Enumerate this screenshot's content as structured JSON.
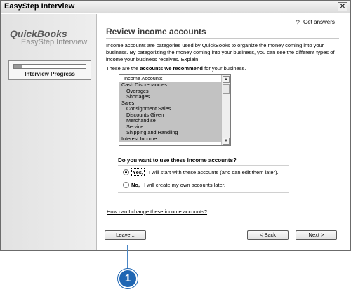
{
  "window": {
    "title": "EasyStep Interview",
    "close_glyph": "✕"
  },
  "sidebar": {
    "brand": "QuickBooks",
    "brand_sub": "EasyStep Interview",
    "progress_label": "Interview Progress",
    "progress_fraction": 0.12
  },
  "help": {
    "icon": "question-icon",
    "link": "Get answers"
  },
  "main": {
    "title": "Review income accounts",
    "intro": "Income accounts are categories used by QuickBooks to organize the money coming into your business. By categorizing the money coming into your business, you can see the different types of income your business receives.",
    "explain_link": "Explain",
    "recommend_prefix": "These are the ",
    "recommend_bold": "accounts we recommend",
    "recommend_suffix": " for your business.",
    "list_header": "Income Accounts",
    "accounts": [
      {
        "label": "Cash Discrepancies",
        "indent": false
      },
      {
        "label": "Overages",
        "indent": true
      },
      {
        "label": "Shortages",
        "indent": true
      },
      {
        "label": "Sales",
        "indent": false
      },
      {
        "label": "Consignment Sales",
        "indent": true
      },
      {
        "label": "Discounts Given",
        "indent": true
      },
      {
        "label": "Merchandise",
        "indent": true
      },
      {
        "label": "Service",
        "indent": true
      },
      {
        "label": "Shipping and Handling",
        "indent": true
      },
      {
        "label": "Interest Income",
        "indent": false
      }
    ],
    "question": "Do you want to use these income accounts?",
    "options": [
      {
        "label": "Yes,",
        "text": "I will start with these accounts (and can edit them later).",
        "selected": true
      },
      {
        "label": "No,",
        "text": "I will create my own accounts later.",
        "selected": false
      }
    ],
    "faq_link": "How can I change these income accounts?"
  },
  "buttons": {
    "leave": "Leave...",
    "back": "< Back",
    "next": "Next >"
  },
  "callout": {
    "number": "1",
    "color": "#1f66b3"
  }
}
